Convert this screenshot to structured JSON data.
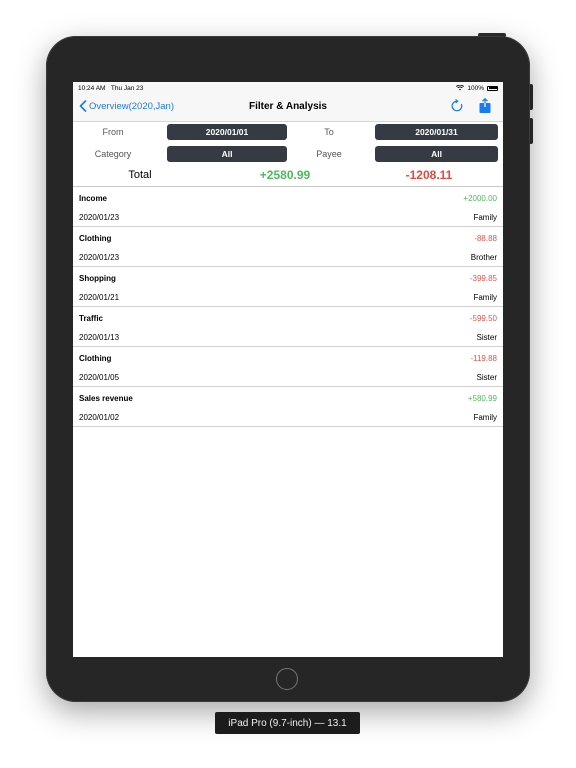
{
  "status": {
    "time": "10:24 AM",
    "date": "Thu Jan 23",
    "battery": "100%"
  },
  "nav": {
    "back_label": "Overview(2020,Jan)",
    "title": "Filter & Analysis"
  },
  "filter": {
    "from_label": "From",
    "from_value": "2020/01/01",
    "to_label": "To",
    "to_value": "2020/01/31",
    "category_label": "Category",
    "category_value": "All",
    "payee_label": "Payee",
    "payee_value": "All"
  },
  "total": {
    "label": "Total",
    "income": "+2580.99",
    "expense": "-1208.11"
  },
  "transactions": [
    {
      "category": "Income",
      "amount": "+2000.00",
      "date": "2020/01/23",
      "payee": "Family"
    },
    {
      "category": "Clothing",
      "amount": "-88.88",
      "date": "2020/01/23",
      "payee": "Brother"
    },
    {
      "category": "Shopping",
      "amount": "-399.85",
      "date": "2020/01/21",
      "payee": "Family"
    },
    {
      "category": "Traffic",
      "amount": "-599.50",
      "date": "2020/01/13",
      "payee": "Sister"
    },
    {
      "category": "Clothing",
      "amount": "-119.88",
      "date": "2020/01/05",
      "payee": "Sister"
    },
    {
      "category": "Sales revenue",
      "amount": "+580.99",
      "date": "2020/01/02",
      "payee": "Family"
    }
  ],
  "device_label": "iPad Pro (9.7-inch) — 13.1",
  "colors": {
    "accent": "#1b7af5",
    "income": "#4cba5a",
    "expense": "#e8453c",
    "filter_button": "#363b43"
  },
  "icons": {
    "back": "chevron-left-icon",
    "refresh": "refresh-icon",
    "share": "share-icon",
    "wifi": "wifi-icon",
    "battery": "battery-icon"
  }
}
